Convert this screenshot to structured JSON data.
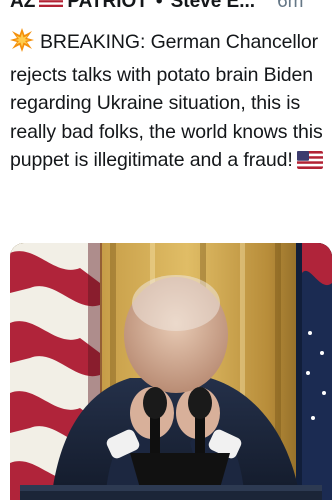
{
  "header": {
    "display_name_start": "AZ",
    "display_name_end": "PATRIOT",
    "separator": "•",
    "handle": "Steve E...",
    "time": "6m"
  },
  "tweet": {
    "text": "BREAKING: German Chancellor rejects talks with potato brain Biden regarding Ukraine situation, this is really bad folks, the world knows this puppet is illegitimate and a fraud!"
  },
  "icons": {
    "lead_emoji": "collision-icon",
    "flag_emoji": "us-flag-icon"
  },
  "colors": {
    "text": "#14171a",
    "muted": "#657786"
  }
}
